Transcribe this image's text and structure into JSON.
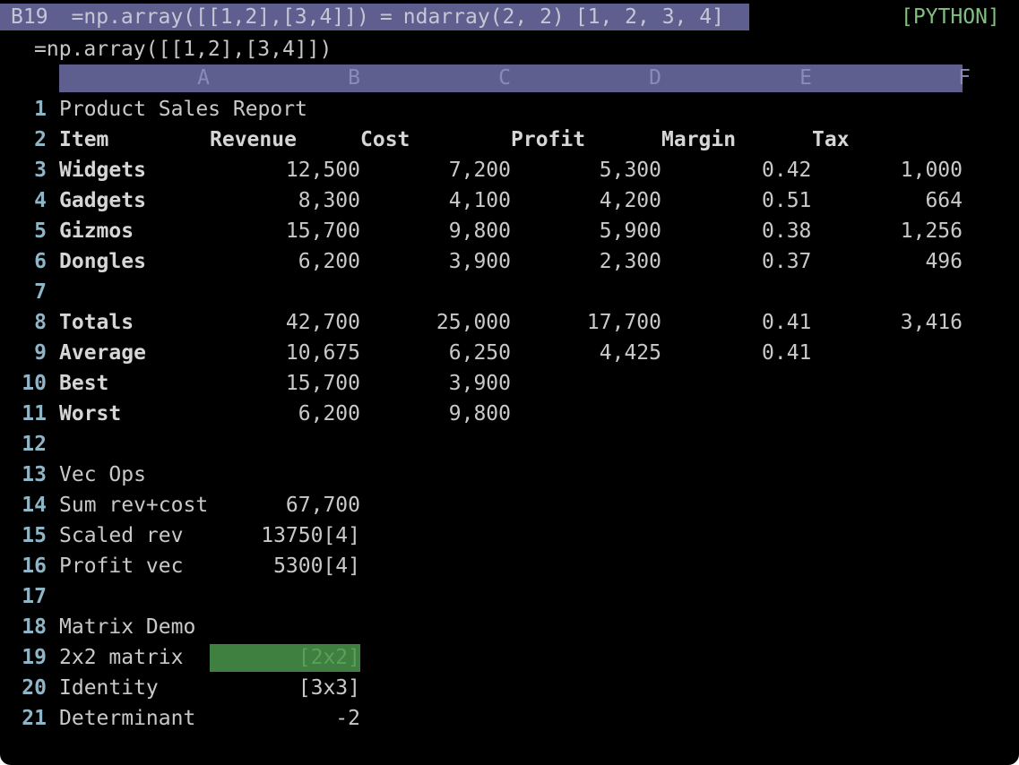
{
  "status": {
    "cell_ref": "B19",
    "formula": "=np.array([[1,2],[3,4]])",
    "equals": "=",
    "result_type": "ndarray(2, 2)",
    "result_value": "[1, 2, 3, 4]",
    "mode": "[PYTHON]"
  },
  "formula_bar": "=np.array([[1,2],[3,4]])",
  "columns": [
    "A",
    "B",
    "C",
    "D",
    "E",
    "F"
  ],
  "rows": [
    {
      "n": "1",
      "a": "Product Sales Report",
      "b": "",
      "c": "",
      "d": "",
      "e": "",
      "f": ""
    },
    {
      "n": "2",
      "a": "Item",
      "b": "Revenue",
      "c": "Cost",
      "d": "Profit",
      "e": "Margin",
      "f": "Tax"
    },
    {
      "n": "3",
      "a": "Widgets",
      "b": "12,500",
      "c": "7,200",
      "d": "5,300",
      "e": "0.42",
      "f": "1,000"
    },
    {
      "n": "4",
      "a": "Gadgets",
      "b": "8,300",
      "c": "4,100",
      "d": "4,200",
      "e": "0.51",
      "f": "664"
    },
    {
      "n": "5",
      "a": "Gizmos",
      "b": "15,700",
      "c": "9,800",
      "d": "5,900",
      "e": "0.38",
      "f": "1,256"
    },
    {
      "n": "6",
      "a": "Dongles",
      "b": "6,200",
      "c": "3,900",
      "d": "2,300",
      "e": "0.37",
      "f": "496"
    },
    {
      "n": "7",
      "a": "",
      "b": "",
      "c": "",
      "d": "",
      "e": "",
      "f": ""
    },
    {
      "n": "8",
      "a": "Totals",
      "b": "42,700",
      "c": "25,000",
      "d": "17,700",
      "e": "0.41",
      "f": "3,416"
    },
    {
      "n": "9",
      "a": "Average",
      "b": "10,675",
      "c": "6,250",
      "d": "4,425",
      "e": "0.41",
      "f": ""
    },
    {
      "n": "10",
      "a": "Best",
      "b": "15,700",
      "c": "3,900",
      "d": "",
      "e": "",
      "f": ""
    },
    {
      "n": "11",
      "a": "Worst",
      "b": "6,200",
      "c": "9,800",
      "d": "",
      "e": "",
      "f": ""
    },
    {
      "n": "12",
      "a": "",
      "b": "",
      "c": "",
      "d": "",
      "e": "",
      "f": ""
    },
    {
      "n": "13",
      "a": "Vec Ops",
      "b": "",
      "c": "",
      "d": "",
      "e": "",
      "f": ""
    },
    {
      "n": "14",
      "a": "Sum rev+cost",
      "b": "67,700",
      "c": "",
      "d": "",
      "e": "",
      "f": ""
    },
    {
      "n": "15",
      "a": "Scaled rev",
      "b": "13750[4]",
      "c": "",
      "d": "",
      "e": "",
      "f": ""
    },
    {
      "n": "16",
      "a": "Profit vec",
      "b": "5300[4]",
      "c": "",
      "d": "",
      "e": "",
      "f": ""
    },
    {
      "n": "17",
      "a": "",
      "b": "",
      "c": "",
      "d": "",
      "e": "",
      "f": ""
    },
    {
      "n": "18",
      "a": "Matrix Demo",
      "b": "",
      "c": "",
      "d": "",
      "e": "",
      "f": ""
    },
    {
      "n": "19",
      "a": "2x2 matrix",
      "b": "[2x2]",
      "c": "",
      "d": "",
      "e": "",
      "f": ""
    },
    {
      "n": "20",
      "a": "Identity",
      "b": "[3x3]",
      "c": "",
      "d": "",
      "e": "",
      "f": ""
    },
    {
      "n": "21",
      "a": "Determinant",
      "b": "-2",
      "c": "",
      "d": "",
      "e": "",
      "f": ""
    }
  ],
  "selected_cell": "B19",
  "colors": {
    "status_bg": "#5f5f8f",
    "header_bg": "#5f5f8f",
    "selection_bg": "#3f7f3f",
    "mode_fg": "#7fbf7f",
    "row_number_fg": "#8fb5c6"
  }
}
